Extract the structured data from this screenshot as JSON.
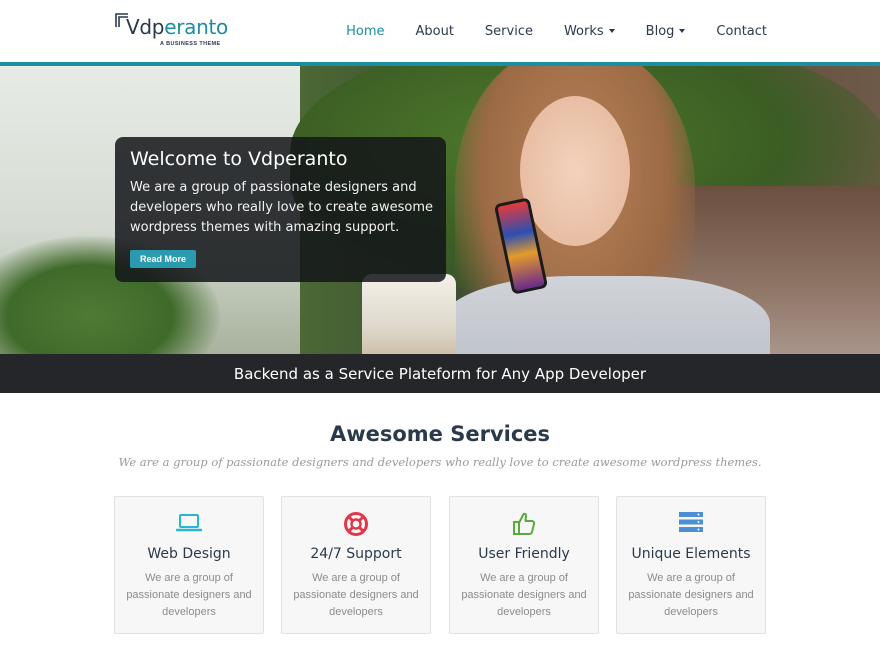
{
  "header": {
    "logo": {
      "text_prefix": "Vdp",
      "text_accent": "eranto",
      "tagline": "A BUSINESS THEME"
    },
    "nav": [
      {
        "label": "Home",
        "active": true,
        "dropdown": false
      },
      {
        "label": "About",
        "active": false,
        "dropdown": false
      },
      {
        "label": "Service",
        "active": false,
        "dropdown": false
      },
      {
        "label": "Works",
        "active": false,
        "dropdown": true
      },
      {
        "label": "Blog",
        "active": false,
        "dropdown": true
      },
      {
        "label": "Contact",
        "active": false,
        "dropdown": false
      }
    ]
  },
  "hero": {
    "title": "Welcome to Vdperanto",
    "text": "We are a group of passionate designers and developers who really love to create awesome wordpress themes with amazing support.",
    "button": "Read More"
  },
  "banner": {
    "text": "Backend as a Service Plateform for Any App Developer"
  },
  "services": {
    "title_bold": "Awesome",
    "title_rest": " Services",
    "subtitle": "We are a group of passionate designers and developers who really love to create awesome wordpress themes.",
    "cards": [
      {
        "icon": "laptop-icon",
        "color": "#29b6d1",
        "title": "Web Design",
        "text": "We are a group of passionate designers and developers"
      },
      {
        "icon": "lifebuoy-icon",
        "color": "#e0384a",
        "title": "24/7 Support",
        "text": "We are a group of passionate designers and developers"
      },
      {
        "icon": "thumbs-up-icon",
        "color": "#5aaa3e",
        "title": "User Friendly",
        "text": "We are a group of passionate designers and developers"
      },
      {
        "icon": "server-icon",
        "color": "#4a8fd6",
        "title": "Unique Elements",
        "text": "We are a group of passionate designers and developers"
      }
    ]
  },
  "colors": {
    "accent": "#1b8ea3",
    "button": "#2a9aaf",
    "banner_bg": "#242629",
    "text_dark": "#2b3a4a"
  }
}
